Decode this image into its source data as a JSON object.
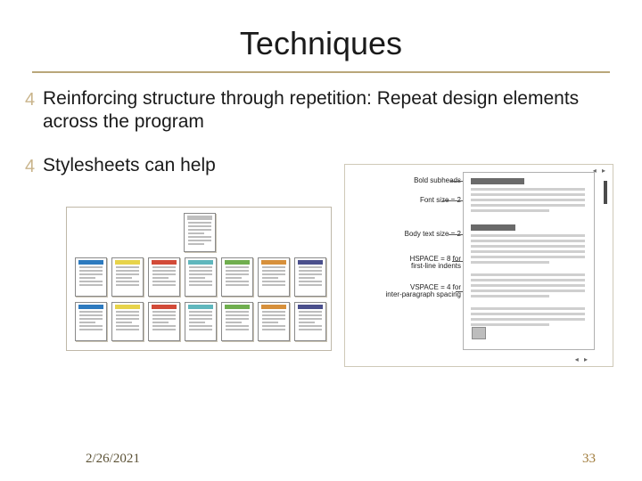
{
  "title": "Techniques",
  "bullets": [
    "Reinforcing structure through repetition: Repeat design elements across the program",
    "Stylesheets can help"
  ],
  "spec_labels": {
    "subhead": "Bold subheads",
    "fontsize": "Font size = 2",
    "bodytext": "Body text size = 2",
    "hspace": "HSPACE = 8 for\nfirst-line indents",
    "vspace": "VSPACE = 4 for\ninter-paragraph spacing"
  },
  "footer": {
    "date": "2/26/2021",
    "page": "33"
  }
}
